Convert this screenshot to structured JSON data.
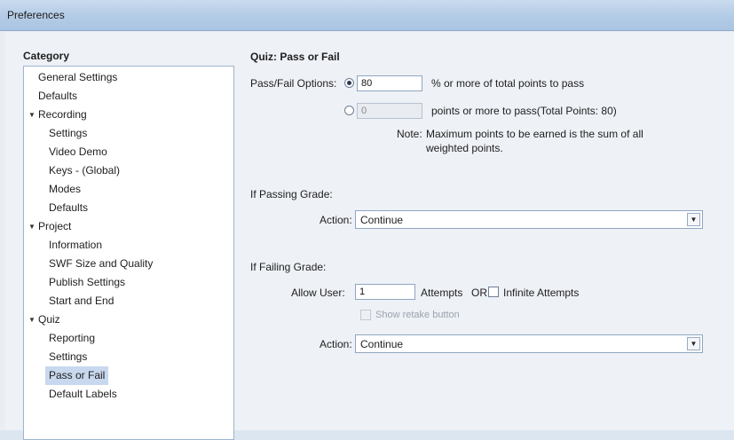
{
  "window": {
    "title": "Preferences"
  },
  "category": {
    "heading": "Category",
    "items": [
      {
        "label": "General Settings",
        "level": 1
      },
      {
        "label": "Defaults",
        "level": 1
      },
      {
        "label": "Recording",
        "level": 0,
        "expanded": true
      },
      {
        "label": "Settings",
        "level": 2
      },
      {
        "label": "Video Demo",
        "level": 2
      },
      {
        "label": "Keys - (Global)",
        "level": 2
      },
      {
        "label": "Modes",
        "level": 2
      },
      {
        "label": "Defaults",
        "level": 2
      },
      {
        "label": "Project",
        "level": 0,
        "expanded": true
      },
      {
        "label": "Information",
        "level": 2
      },
      {
        "label": "SWF Size and Quality",
        "level": 2
      },
      {
        "label": "Publish Settings",
        "level": 2
      },
      {
        "label": "Start and End",
        "level": 2
      },
      {
        "label": "Quiz",
        "level": 0,
        "expanded": true
      },
      {
        "label": "Reporting",
        "level": 2
      },
      {
        "label": "Settings",
        "level": 2
      },
      {
        "label": "Pass or Fail",
        "level": 2,
        "selected": true
      },
      {
        "label": "Default Labels",
        "level": 2
      }
    ]
  },
  "panel": {
    "title": "Quiz: Pass or Fail",
    "pass_fail_label": "Pass/Fail Options:",
    "option_percent": {
      "value": "80",
      "suffix": "% or more of total points to pass",
      "selected": true
    },
    "option_points": {
      "value": "0",
      "suffix": "points or more to pass(Total Points: 80)",
      "selected": false
    },
    "note_label": "Note:",
    "note_line1": "Maximum points to be earned is the sum of all",
    "note_line2": "weighted points.",
    "passing": {
      "heading": "If Passing Grade:",
      "action_label": "Action:",
      "action_value": "Continue"
    },
    "failing": {
      "heading": "If Failing Grade:",
      "allow_label": "Allow User:",
      "attempts_value": "1",
      "attempts_text": "Attempts",
      "or_text": "OR",
      "infinite_label": "Infinite Attempts",
      "retake_label": "Show retake button",
      "action_label": "Action:",
      "action_value": "Continue"
    }
  }
}
